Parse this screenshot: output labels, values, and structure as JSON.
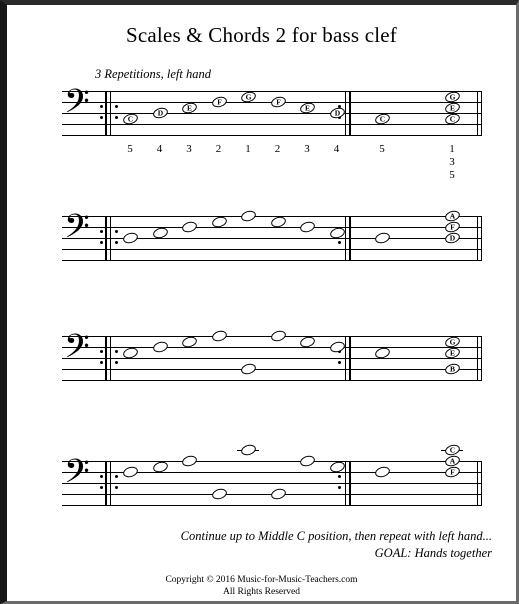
{
  "document": {
    "title": "Scales & Chords 2 for bass clef",
    "subtitle": "3 Repetitions, left hand",
    "footnote_line1": "Continue up to Middle C position, then repeat with left hand...",
    "footnote_line2": "GOAL: Hands together",
    "copyright_line1": "Copyright © 2016 Music-for-Music-Teachers.com",
    "copyright_line2": "All Rights Reserved",
    "clef_glyph": "𝄢",
    "clef_name": "bass-clef"
  },
  "chart_data": {
    "type": "table",
    "title": "Scales & Chords 2 for bass clef",
    "notation": "staff",
    "clef": "bass",
    "systems": [
      {
        "index": 1,
        "start_note": "C",
        "repeat_open": true,
        "repeat_close": true,
        "labels_shown": true,
        "scale_notes": [
          "C",
          "D",
          "E",
          "F",
          "G",
          "F",
          "E",
          "D"
        ],
        "scale_steps": [
          0,
          1,
          2,
          3,
          4,
          3,
          2,
          1
        ],
        "final_single_note": "C",
        "final_chord": [
          "C",
          "E",
          "G"
        ],
        "fingerings": [
          "5",
          "4",
          "3",
          "2",
          "1",
          "2",
          "3",
          "4"
        ],
        "final_single_fingering": "5",
        "final_chord_fingering": [
          "1",
          "3",
          "5"
        ]
      },
      {
        "index": 2,
        "start_note": "D",
        "repeat_open": true,
        "repeat_close": true,
        "labels_shown": false,
        "scale_notes": [
          "D",
          "E",
          "F",
          "G",
          "A",
          "G",
          "F",
          "E"
        ],
        "scale_steps": [
          0,
          1,
          2,
          3,
          4,
          3,
          2,
          1
        ],
        "final_single_note": "D",
        "final_chord": [
          "D",
          "F",
          "A"
        ],
        "fingerings": [],
        "final_single_fingering": "",
        "final_chord_fingering": []
      },
      {
        "index": 3,
        "start_note": "E",
        "repeat_open": true,
        "repeat_close": true,
        "labels_shown": false,
        "scale_notes": [
          "E",
          "F",
          "G",
          "A",
          "B",
          "A",
          "G",
          "F"
        ],
        "scale_steps": [
          0,
          1,
          2,
          3,
          4,
          3,
          2,
          1
        ],
        "final_single_note": "E",
        "final_chord": [
          "E",
          "G",
          "B"
        ],
        "fingerings": [],
        "final_single_fingering": "",
        "final_chord_fingering": []
      },
      {
        "index": 4,
        "start_note": "F",
        "repeat_open": true,
        "repeat_close": true,
        "labels_shown": false,
        "scale_notes": [
          "F",
          "G",
          "A",
          "B",
          "C",
          "B",
          "A",
          "G"
        ],
        "scale_steps": [
          0,
          1,
          2,
          3,
          4,
          3,
          2,
          1
        ],
        "final_single_note": "F",
        "final_chord": [
          "F",
          "A",
          "C"
        ],
        "fingerings": [],
        "final_single_fingering": "",
        "final_chord_fingering": []
      }
    ]
  },
  "colors": {
    "ink": "#000000",
    "paper": "#ffffff",
    "border": "#171717"
  }
}
